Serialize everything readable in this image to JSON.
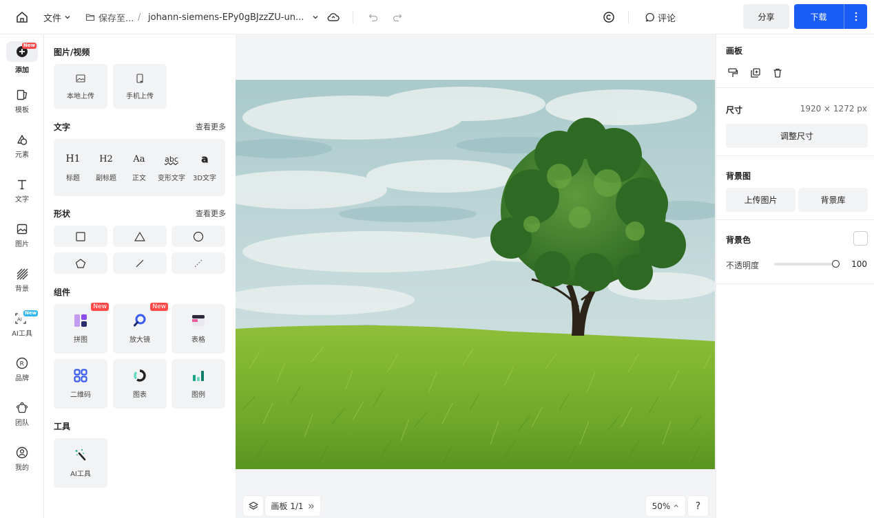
{
  "topbar": {
    "file_menu": "文件",
    "save_to": "保存至...",
    "path_sep": "/",
    "doc_title": "johann-siemens-EPy0gBJzzZU-un...",
    "comment": "评论",
    "share": "分享",
    "download": "下载"
  },
  "leftnav": {
    "items": [
      {
        "label": "添加",
        "icon": "add-icon",
        "badge": "New"
      },
      {
        "label": "模板",
        "icon": "template-icon"
      },
      {
        "label": "元素",
        "icon": "elements-icon"
      },
      {
        "label": "文字",
        "icon": "text-icon"
      },
      {
        "label": "图片",
        "icon": "image-icon"
      },
      {
        "label": "背景",
        "icon": "background-icon"
      },
      {
        "label": "AI工具",
        "icon": "ai-tools-icon",
        "badge": "New"
      },
      {
        "label": "品牌",
        "icon": "brand-icon"
      },
      {
        "label": "团队",
        "icon": "team-icon"
      },
      {
        "label": "我的",
        "icon": "user-icon"
      }
    ]
  },
  "panel": {
    "media_title": "图片/视频",
    "local_upload": "本地上传",
    "phone_upload": "手机上传",
    "text_title": "文字",
    "see_more": "查看更多",
    "text_items": [
      {
        "glyph": "H1",
        "label": "标题"
      },
      {
        "glyph": "H2",
        "label": "副标题"
      },
      {
        "glyph": "Aa",
        "label": "正文"
      },
      {
        "glyph": "abc",
        "label": "变形文字"
      },
      {
        "glyph": "a",
        "label": "3D文字"
      }
    ],
    "shapes_title": "形状",
    "components_title": "组件",
    "components": [
      {
        "label": "拼图",
        "badge": "New"
      },
      {
        "label": "放大镜",
        "badge": "New"
      },
      {
        "label": "表格"
      },
      {
        "label": "二维码"
      },
      {
        "label": "图表"
      },
      {
        "label": "图例"
      }
    ],
    "tools_title": "工具",
    "ai_tool": "AI工具"
  },
  "canvas": {
    "artboard_label": "画板 1/1",
    "zoom": "50%",
    "help": "?"
  },
  "right": {
    "artboard_title": "画板",
    "size_label": "尺寸",
    "size_value": "1920 × 1272 px",
    "resize_button": "调整尺寸",
    "bg_image_title": "背景图",
    "upload_image": "上传图片",
    "bg_library": "背景库",
    "bg_color_title": "背景色",
    "opacity_label": "不透明度",
    "opacity_value": "100"
  },
  "colors": {
    "primary": "#1a5cf6",
    "badge_red": "#ff4a4a",
    "panel_bg": "#f2f3f5"
  }
}
